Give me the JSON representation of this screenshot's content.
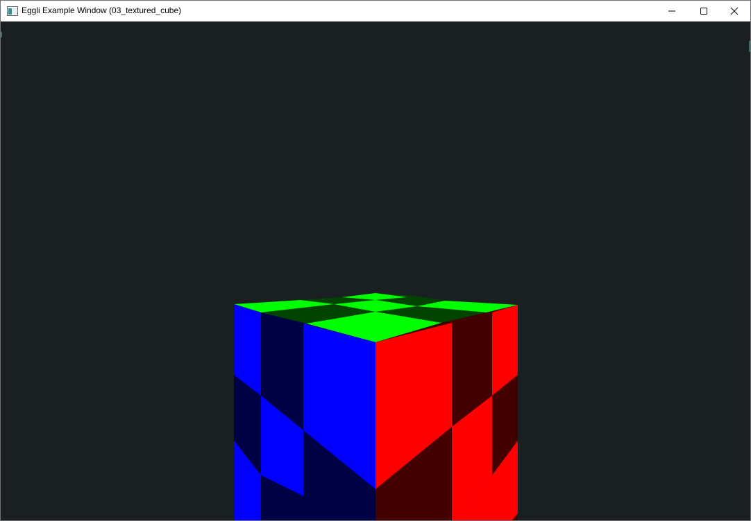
{
  "window": {
    "title": "Eggli Example Window (03_textured_cube)"
  },
  "titlebar": {
    "app_icon": "window-app-icon",
    "minimize_icon": "minimize-icon",
    "maximize_icon": "maximize-icon",
    "close_icon": "close-icon"
  },
  "scene": {
    "background_color": "#1a1f21",
    "object": "textured-cube",
    "face_colors": {
      "top_bright": "#00ff00",
      "top_dark": "#004400",
      "left_bright": "#0000ff",
      "left_dark": "#000044",
      "right_bright": "#ff0000",
      "right_dark": "#440000"
    }
  }
}
